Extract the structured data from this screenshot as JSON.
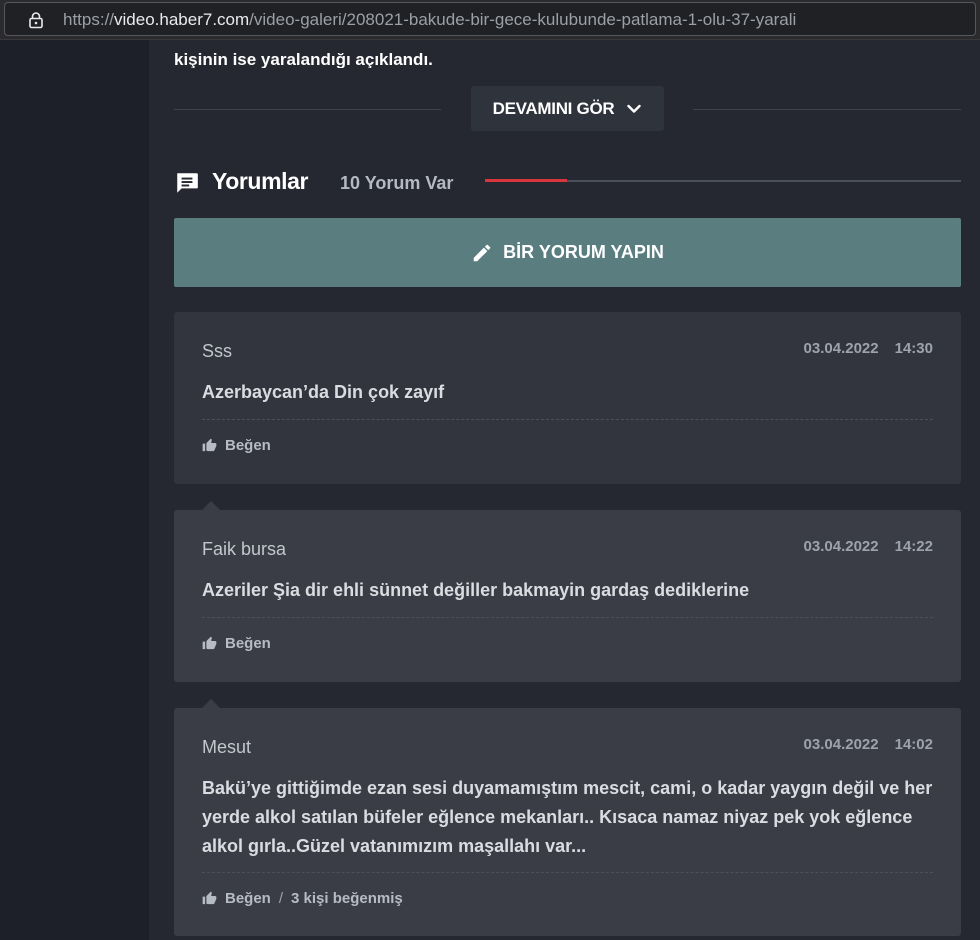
{
  "browser": {
    "url_scheme": "https://",
    "url_host": "video.haber7.com",
    "url_path": "/video-galeri/208021-bakude-bir-gece-kulubunde-patlama-1-olu-37-yarali"
  },
  "article": {
    "tail_text": "kişinin ise yaralandığı açıklandı.",
    "more_label": "DEVAMINI GÖR"
  },
  "comments_section": {
    "title": "Yorumlar",
    "count_label": "10 Yorum Var",
    "write_label": "BİR YORUM YAPIN",
    "accent_color": "#d9353d",
    "write_button_color": "#5a7e80"
  },
  "comments": [
    {
      "author": "Sss",
      "date": "03.04.2022",
      "time": "14:30",
      "text": "Azerbaycan’da Din çok zayıf",
      "like_label": "Beğen",
      "likes_text": ""
    },
    {
      "author": "Faik bursa",
      "date": "03.04.2022",
      "time": "14:22",
      "text": "Azeriler Şia dir ehli sünnet değiller bakmayin gardaş dediklerine",
      "like_label": "Beğen",
      "likes_text": ""
    },
    {
      "author": "Mesut",
      "date": "03.04.2022",
      "time": "14:02",
      "text": "Bakü’ye gittiğimde ezan sesi duyamamıştım mescit, cami, o kadar yaygın değil ve her yerde alkol satılan büfeler eğlence mekanları.. Kısaca namaz niyaz pek yok eğlence alkol gırla..Güzel vatanımızım maşallahı var...",
      "like_label": "Beğen",
      "likes_separator": "/",
      "likes_text": "3 kişi beğenmiş"
    }
  ],
  "icons": {
    "lock": "lock-icon",
    "chevron": "chevron-down-icon",
    "comments": "comment-bubble-icon",
    "write": "pencil-icon",
    "like": "thumbs-up-icon"
  }
}
